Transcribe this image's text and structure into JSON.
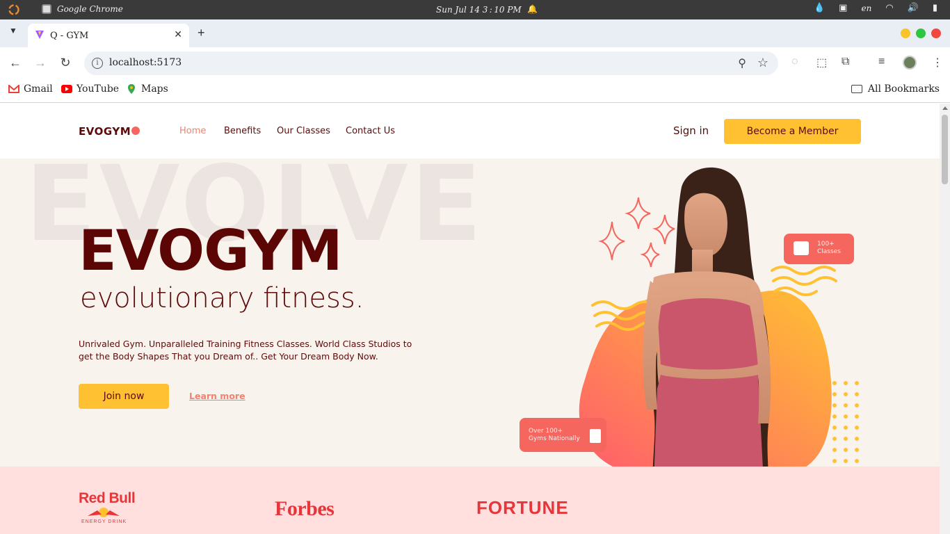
{
  "os": {
    "app_name": "Google Chrome",
    "clock": "Sun Jul 14   3 : 10 PM",
    "lang": "en"
  },
  "browser": {
    "tab_title": "Q - GYM",
    "url": "localhost:5173",
    "bookmarks": [
      {
        "label": "Gmail",
        "icon": "gmail-icon"
      },
      {
        "label": "YouTube",
        "icon": "youtube-icon"
      },
      {
        "label": "Maps",
        "icon": "maps-icon"
      }
    ],
    "all_bookmarks": "All Bookmarks"
  },
  "site": {
    "logo": "EVOGYM",
    "nav": [
      {
        "label": "Home",
        "active": true
      },
      {
        "label": "Benefits",
        "active": false
      },
      {
        "label": "Our Classes",
        "active": false
      },
      {
        "label": "Contact Us",
        "active": false
      }
    ],
    "sign_in": "Sign in",
    "cta": "Become a Member"
  },
  "hero": {
    "watermark": "EVOLVE",
    "title": "EVOGYM",
    "subtitle": "evolutionary fitness.",
    "description": "Unrivaled Gym. Unparalleled Training Fitness Classes. World Class Studios to get the Body Shapes That you Dream of.. Get Your Dream Body Now.",
    "join": "Join now",
    "learn_more": "Learn more",
    "badge_classes_line1": "100+",
    "badge_classes_line2": "Classes",
    "badge_gyms_line1": "Over 100+",
    "badge_gyms_line2": "Gyms Nationally"
  },
  "sponsors": {
    "redbull": "Red Bull",
    "redbull_sub": "ENERGY DRINK",
    "forbes": "Forbes",
    "fortune": "FORTUNE"
  },
  "colors": {
    "primary_dark": "#5c0a0a",
    "accent_yellow": "#ffc132",
    "accent_coral": "#f4665e",
    "hero_bg": "#f8f3ec",
    "sponsor_bg": "#ffe0df"
  }
}
